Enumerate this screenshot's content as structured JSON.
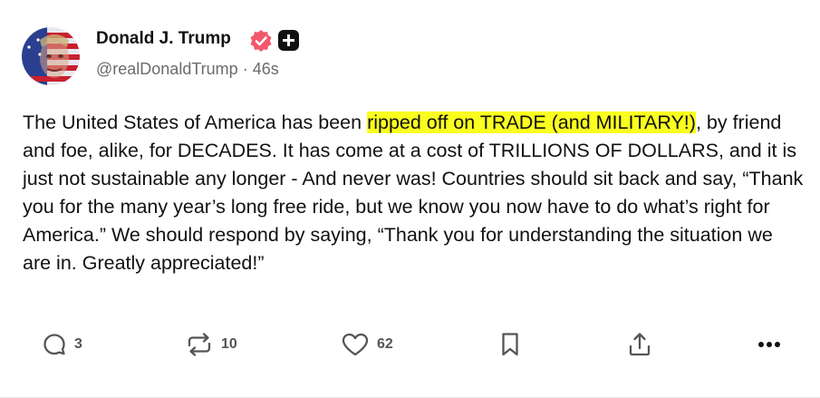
{
  "author": {
    "name": "Donald J. Trump",
    "handle": "@realDonaldTrump",
    "separator": "·",
    "timestamp": "46s"
  },
  "post": {
    "text_before": "The United States of America has been ",
    "highlighted": "ripped off on TRADE (and MILITARY!)",
    "text_after": ", by friend and foe, alike, for DECADES. It has come at a cost of TRILLIONS OF DOLLARS, and it is just not sustainable any longer - And never was! Countries should sit back and say, “Thank you for the many year’s long free ride, but we know you now have to do what’s right for America.” We should respond by saying, “Thank you for understanding the situation we are in. Greatly appreciated!”"
  },
  "actions": {
    "replies": "3",
    "reposts": "10",
    "likes": "62"
  },
  "colors": {
    "verified_badge": "#f2596b",
    "highlight": "#faff1f",
    "icon_gray": "#555555"
  }
}
